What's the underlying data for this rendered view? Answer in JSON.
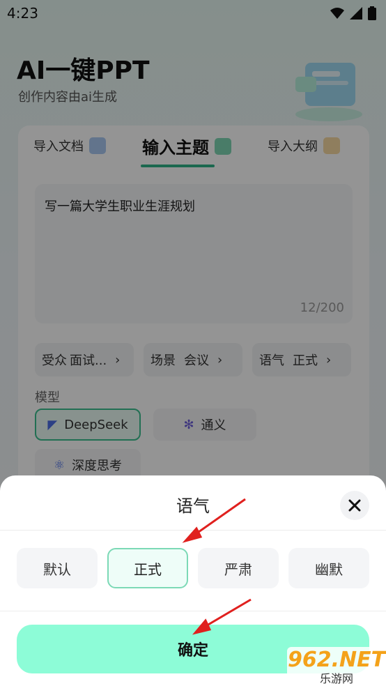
{
  "status": {
    "time": "4:23"
  },
  "header": {
    "title": "AI一键PPT",
    "subtitle": "创作内容由ai生成"
  },
  "tabs": [
    {
      "label": "导入文档"
    },
    {
      "label": "输入主题"
    },
    {
      "label": "导入大纲"
    }
  ],
  "input": {
    "value": "写一篇大学生职业生涯规划",
    "counter": "12/200"
  },
  "chips": {
    "audience": {
      "label": "受众",
      "value": "面试..."
    },
    "scene": {
      "label": "场景",
      "value": "会议"
    },
    "tone": {
      "label": "语气",
      "value": "正式"
    }
  },
  "models": {
    "label": "模型",
    "deepseek": "DeepSeek",
    "tongyi": "通义",
    "deep_think": "深度思考"
  },
  "sheet": {
    "title": "语气",
    "options": [
      "默认",
      "正式",
      "严肃",
      "幽默"
    ],
    "selected": "正式",
    "confirm": "确定"
  },
  "watermark": {
    "big": "962.NET",
    "small": "乐游网"
  },
  "colors": {
    "accent": "#2fb489",
    "confirm_bg": "#8dfcd7",
    "selected_border": "#7cd9b6"
  }
}
